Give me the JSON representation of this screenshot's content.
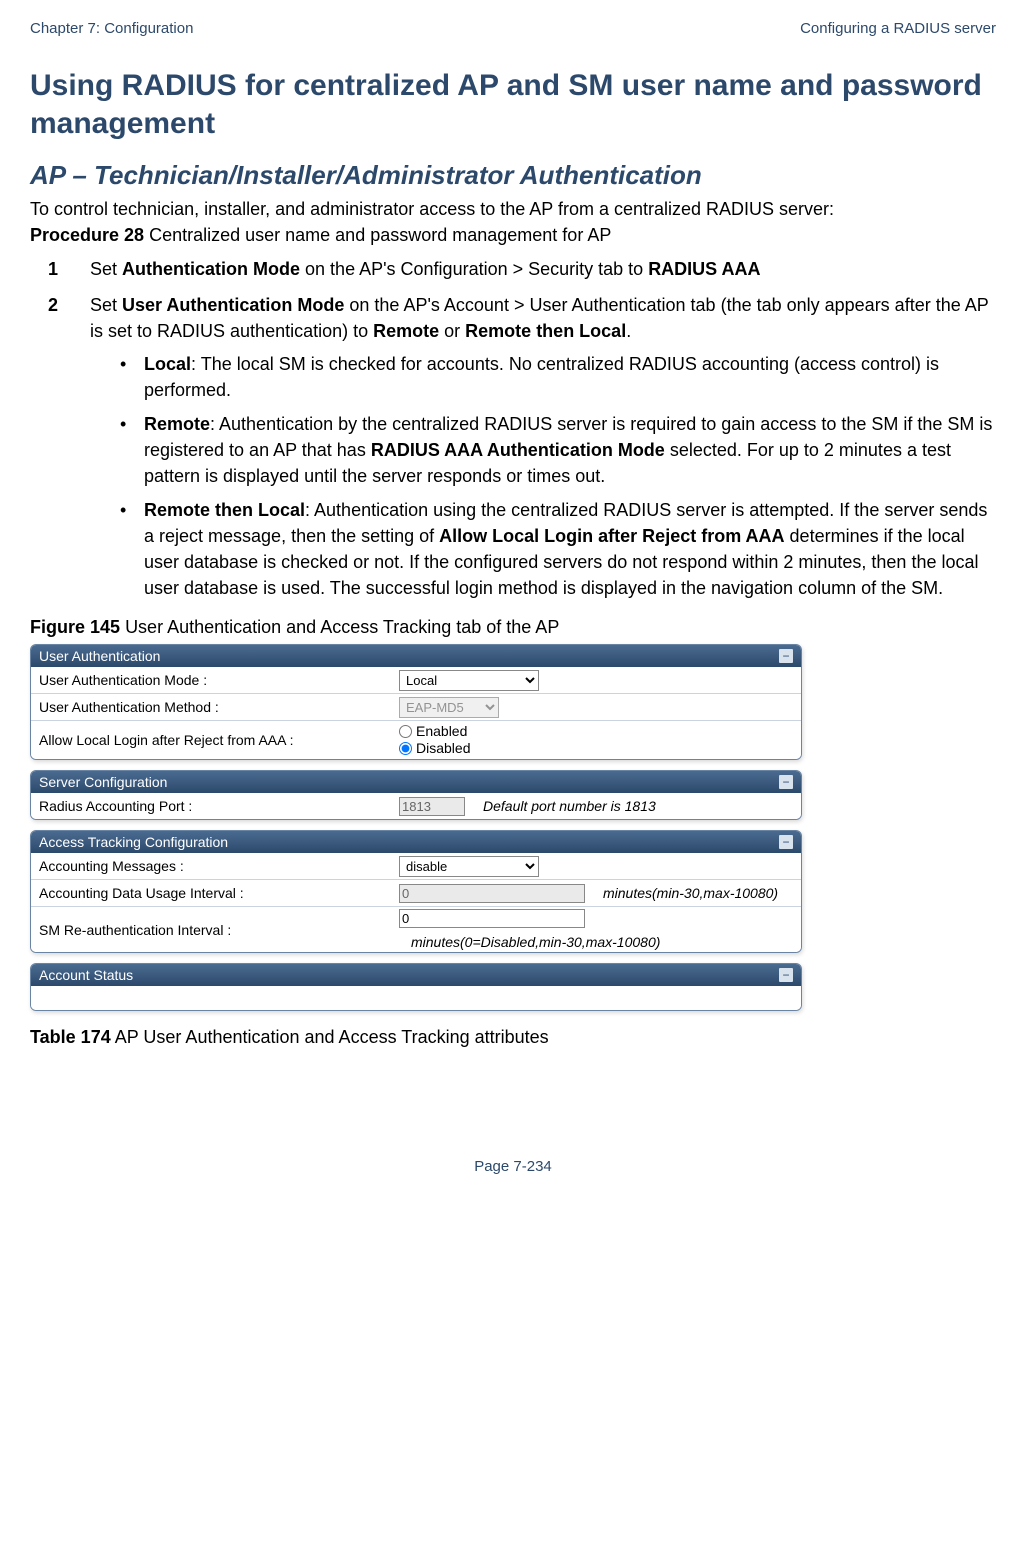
{
  "header": {
    "left": "Chapter 7:  Configuration",
    "right": "Configuring a RADIUS server"
  },
  "title": "Using RADIUS for centralized AP and SM user name and password management",
  "subtitle": "AP – Technician/Installer/Administrator Authentication",
  "intro": "To control technician, installer, and administrator access to the AP from a centralized RADIUS server:",
  "procedure": {
    "label": "Procedure 28",
    "text": "Centralized user name and password management for AP"
  },
  "steps": [
    {
      "num": "1",
      "prefix": "Set ",
      "bold1": "Authentication Mode",
      "mid": " on the AP's Configuration > Security tab to ",
      "bold2": "RADIUS AAA"
    },
    {
      "num": "2",
      "prefix": "Set ",
      "bold1": "User Authentication Mode",
      "mid": " on the AP's Account > User Authentication tab (the tab only appears after the AP is set to RADIUS authentication) to ",
      "bold2": "Remote",
      "mid2": " or ",
      "bold3": "Remote then Local",
      "suffix": ".",
      "bullets": [
        {
          "lead": "Local",
          "text": ": The local SM is checked for accounts. No centralized RADIUS accounting (access control) is performed."
        },
        {
          "lead": "Remote",
          "text_a": ": Authentication by the centralized RADIUS server is required to gain access to the SM if the SM is registered to an AP that has ",
          "bold": "RADIUS AAA Authentication Mode",
          "text_b": " selected. For up to 2 minutes a test pattern is displayed until the server responds or times out."
        },
        {
          "lead": "Remote then Local",
          "text_a": ": Authentication using the centralized RADIUS server is attempted. If the server sends a reject message, then the setting of ",
          "bold": "Allow Local Login after Reject from AAA",
          "text_b": " determines if the local user database is checked or not. If the configured servers do not respond within 2 minutes, then the local user database is used. The successful login method is displayed in the navigation column of the SM."
        }
      ]
    }
  ],
  "figure": {
    "label": "Figure 145",
    "caption": "User Authentication and Access Tracking tab of the AP"
  },
  "panels": {
    "user_auth": {
      "title": "User Authentication",
      "toggle": "−",
      "rows": {
        "mode_label": "User Authentication Mode :",
        "mode_value": "Local",
        "method_label": "User Authentication Method :",
        "method_value": "EAP-MD5",
        "allow_label": "Allow Local Login after Reject from AAA :",
        "enabled": "Enabled",
        "disabled": "Disabled"
      }
    },
    "server_cfg": {
      "title": "Server Configuration",
      "toggle": "−",
      "port_label": "Radius Accounting Port :",
      "port_value": "1813",
      "port_hint": "Default port number is 1813"
    },
    "access_tracking": {
      "title": "Access Tracking Configuration",
      "toggle": "−",
      "msgs_label": "Accounting Messages :",
      "msgs_value": "disable",
      "interval_label": "Accounting Data Usage Interval :",
      "interval_value": "0",
      "interval_hint": "minutes(min-30,max-10080)",
      "reauth_label": "SM Re-authentication Interval :",
      "reauth_value": "0",
      "reauth_hint": "minutes(0=Disabled,min-30,max-10080)"
    },
    "account_status": {
      "title": "Account Status",
      "toggle": "−"
    }
  },
  "table": {
    "label": "Table 174",
    "caption": "AP User Authentication and Access Tracking attributes"
  },
  "footer": "Page 7-234"
}
